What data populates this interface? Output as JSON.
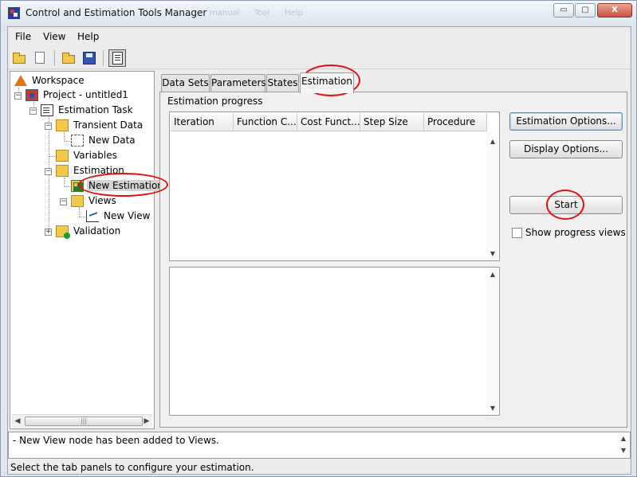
{
  "window": {
    "title": "Control and Estimation Tools Manager",
    "ghost_title_bits": [
      "manual",
      "Tool",
      "Help"
    ],
    "controls": {
      "minimize": "▭",
      "maximize": "▢",
      "close": "X"
    }
  },
  "menubar": {
    "items": [
      "File",
      "View",
      "Help"
    ]
  },
  "toolbar": {
    "icons": [
      "open-folder-icon",
      "new-document-icon",
      "open-folder-icon",
      "save-disk-icon",
      "document-list-icon"
    ]
  },
  "tree": {
    "nodes": [
      {
        "label": "Workspace",
        "icon": "workspace-icon"
      },
      {
        "label": "Project - untitled1",
        "icon": "project-icon"
      },
      {
        "label": "Estimation Task",
        "icon": "task-icon"
      },
      {
        "label": "Transient Data",
        "icon": "folder-icon"
      },
      {
        "label": "New Data",
        "icon": "data-icon"
      },
      {
        "label": "Variables",
        "icon": "folder-icon"
      },
      {
        "label": "Estimation",
        "icon": "folder-icon"
      },
      {
        "label": "New Estimation",
        "icon": "grid-icon",
        "selected": true
      },
      {
        "label": "Views",
        "icon": "folder-icon"
      },
      {
        "label": "New View",
        "icon": "view-plot-icon"
      },
      {
        "label": "Validation",
        "icon": "folder-check-icon"
      }
    ],
    "expander_minus": "−",
    "expander_plus": "+",
    "scroll_thumb": "|||",
    "scroll_left": "◀",
    "scroll_right": "▶"
  },
  "tabs": [
    "Data Sets",
    "Parameters",
    "States",
    "Estimation"
  ],
  "active_tab": "Estimation",
  "estimation": {
    "group_label": "Estimation progress",
    "columns": [
      "Iteration",
      "Function C...",
      "Cost Funct...",
      "Step Size",
      "Procedure"
    ],
    "scroll_up": "▲",
    "scroll_down": "▼",
    "buttons": {
      "estimation_options": "Estimation Options...",
      "display_options": "Display Options...",
      "start": "Start"
    },
    "show_progress_views": {
      "label": "Show progress views",
      "checked": false
    }
  },
  "log": {
    "message": "- New View node has been added to Views."
  },
  "status": {
    "message": "Select the tab panels to configure your estimation."
  },
  "annotation_color": "#e01010"
}
